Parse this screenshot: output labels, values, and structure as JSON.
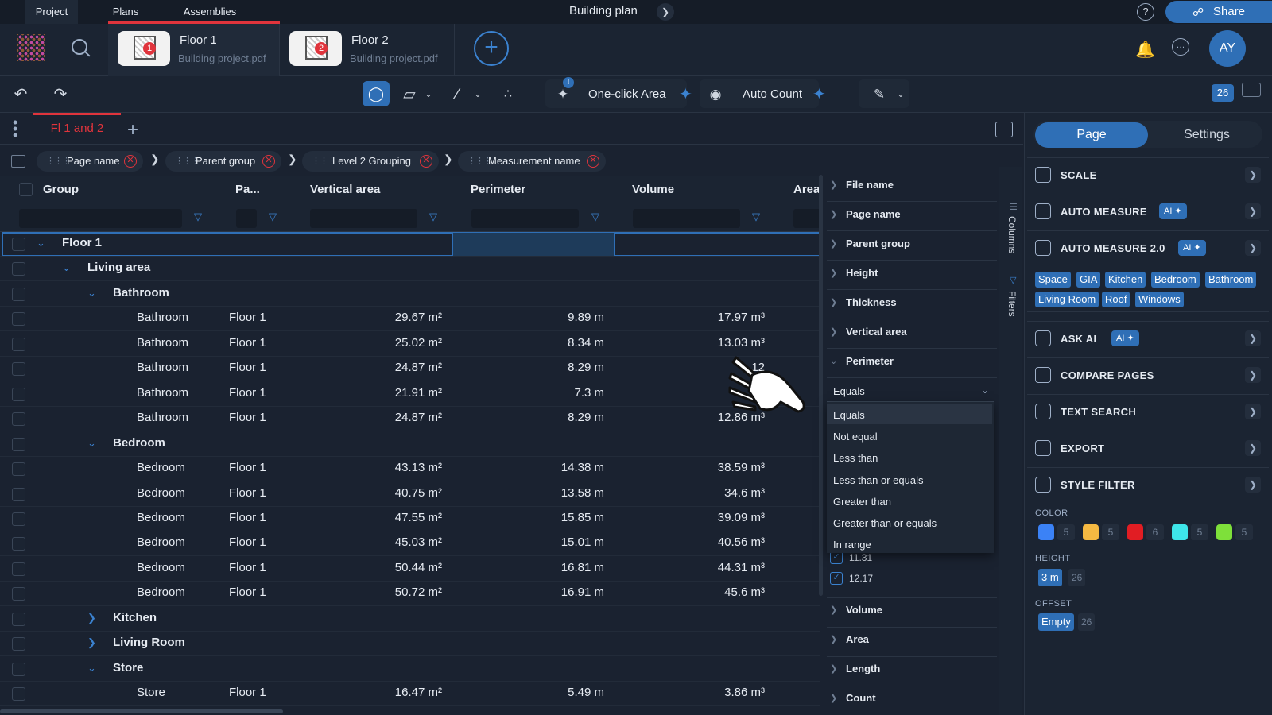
{
  "app": {
    "tabs": [
      "Project",
      "Plans",
      "Assemblies"
    ],
    "title": "Building plan",
    "share_label": "Share",
    "avatar_initials": "AY"
  },
  "documents": [
    {
      "title": "Floor 1",
      "subtitle": "Building project.pdf",
      "badge": "1"
    },
    {
      "title": "Floor 2",
      "subtitle": "Building project.pdf",
      "badge": "2"
    }
  ],
  "toolbar": {
    "one_click_label": "One-click Area",
    "auto_count_label": "Auto Count",
    "count_badge": "26"
  },
  "view": {
    "tab_label": "Fl 1 and 2",
    "groupings": [
      "Page name",
      "Parent group",
      "Level 2 Grouping",
      "Measurement name"
    ]
  },
  "table": {
    "headers": [
      "Group",
      "Pa...",
      "Vertical area",
      "Perimeter",
      "Volume",
      "Area"
    ],
    "rows": [
      {
        "type": "group",
        "level": 0,
        "name": "Floor 1",
        "expanded": true
      },
      {
        "type": "group",
        "level": 1,
        "name": "Living area",
        "expanded": true
      },
      {
        "type": "group",
        "level": 2,
        "name": "Bathroom",
        "expanded": true
      },
      {
        "type": "item",
        "name": "Bathroom",
        "page": "Floor 1",
        "vertical_area": "29.67 m²",
        "perimeter": "9.89 m",
        "volume": "17.97 m³"
      },
      {
        "type": "item",
        "name": "Bathroom",
        "page": "Floor 1",
        "vertical_area": "25.02 m²",
        "perimeter": "8.34 m",
        "volume": "13.03 m³"
      },
      {
        "type": "item",
        "name": "Bathroom",
        "page": "Floor 1",
        "vertical_area": "24.87 m²",
        "perimeter": "8.29 m",
        "volume": "12"
      },
      {
        "type": "item",
        "name": "Bathroom",
        "page": "Floor 1",
        "vertical_area": "21.91 m²",
        "perimeter": "7.3 m",
        "volume": "9."
      },
      {
        "type": "item",
        "name": "Bathroom",
        "page": "Floor 1",
        "vertical_area": "24.87 m²",
        "perimeter": "8.29 m",
        "volume": "12.86 m³"
      },
      {
        "type": "group",
        "level": 2,
        "name": "Bedroom",
        "expanded": true
      },
      {
        "type": "item",
        "name": "Bedroom",
        "page": "Floor 1",
        "vertical_area": "43.13 m²",
        "perimeter": "14.38 m",
        "volume": "38.59 m³"
      },
      {
        "type": "item",
        "name": "Bedroom",
        "page": "Floor 1",
        "vertical_area": "40.75 m²",
        "perimeter": "13.58 m",
        "volume": "34.6 m³"
      },
      {
        "type": "item",
        "name": "Bedroom",
        "page": "Floor 1",
        "vertical_area": "47.55 m²",
        "perimeter": "15.85 m",
        "volume": "39.09 m³"
      },
      {
        "type": "item",
        "name": "Bedroom",
        "page": "Floor 1",
        "vertical_area": "45.03 m²",
        "perimeter": "15.01 m",
        "volume": "40.56 m³"
      },
      {
        "type": "item",
        "name": "Bedroom",
        "page": "Floor 1",
        "vertical_area": "50.44 m²",
        "perimeter": "16.81 m",
        "volume": "44.31 m³"
      },
      {
        "type": "item",
        "name": "Bedroom",
        "page": "Floor 1",
        "vertical_area": "50.72 m²",
        "perimeter": "16.91 m",
        "volume": "45.6 m³"
      },
      {
        "type": "group",
        "level": 2,
        "name": "Kitchen",
        "expanded": false
      },
      {
        "type": "group",
        "level": 2,
        "name": "Living Room",
        "expanded": false
      },
      {
        "type": "group",
        "level": 2,
        "name": "Store",
        "expanded": true
      },
      {
        "type": "item",
        "name": "Store",
        "page": "Floor 1",
        "vertical_area": "16.47 m²",
        "perimeter": "5.49 m",
        "volume": "3.86 m³"
      }
    ]
  },
  "column_panel": {
    "items_top": [
      "File name",
      "Page name",
      "Parent group",
      "Height",
      "Thickness",
      "Vertical area",
      "Perimeter"
    ],
    "items_bottom": [
      "Volume",
      "Area",
      "Length",
      "Count"
    ],
    "side_tabs": [
      "Columns",
      "Filters"
    ],
    "filter_selected": "Equals",
    "filter_options": [
      "Equals",
      "Not equal",
      "Less than",
      "Less than or equals",
      "Greater than",
      "Greater than or equals",
      "In range"
    ],
    "checked_values": [
      "11.31",
      "12.17"
    ]
  },
  "right_panel": {
    "tabs": [
      "Page",
      "Settings"
    ],
    "items": [
      "SCALE",
      "AUTO MEASURE",
      "AUTO MEASURE 2.0",
      "ASK AI",
      "COMPARE PAGES",
      "TEXT SEARCH",
      "EXPORT",
      "STYLE FILTER"
    ],
    "ai_badge": "AI",
    "auto_measure_tags": [
      "Space",
      "GIA",
      "Kitchen",
      "Bedroom",
      "Bathroom",
      "Living Room",
      "Roof",
      "Windows"
    ],
    "color_label": "COLOR",
    "colors": [
      {
        "hex": "#3b82f6",
        "count": "5"
      },
      {
        "hex": "#f5b942",
        "count": "5"
      },
      {
        "hex": "#e11d23",
        "count": "6"
      },
      {
        "hex": "#3ee6ea",
        "count": "5"
      },
      {
        "hex": "#7ee03a",
        "count": "5"
      }
    ],
    "height_label": "HEIGHT",
    "height_value": "3 m",
    "height_count": "26",
    "offset_label": "OFFSET",
    "offset_value": "Empty",
    "offset_count": "26"
  }
}
